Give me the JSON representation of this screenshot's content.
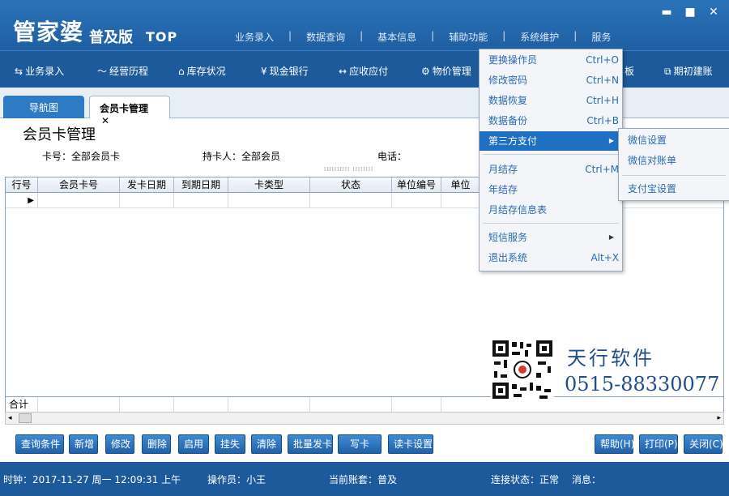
{
  "app": {
    "logo_main": "管家婆",
    "logo_sub": "普及版",
    "logo_top": "TOP",
    "top_menu": [
      "业务录入",
      "数据查询",
      "基本信息",
      "辅助功能",
      "系统维护",
      "服务"
    ]
  },
  "toolbar": {
    "items": [
      {
        "icon": "⇆",
        "label": "业务录入"
      },
      {
        "icon": "〜",
        "label": "经营历程"
      },
      {
        "icon": "⌂",
        "label": "库存状况"
      },
      {
        "icon": "¥",
        "label": "现金银行"
      },
      {
        "icon": "↔",
        "label": "应收应付"
      },
      {
        "icon": "⚙",
        "label": "物价管理"
      },
      {
        "icon": "",
        "label": "板"
      },
      {
        "icon": "⧉",
        "label": "期初建账"
      }
    ]
  },
  "tabs": {
    "nav": "导航图",
    "card": "会员卡管理",
    "close": "✕"
  },
  "page": {
    "title": "会员卡管理",
    "filter_card": "卡号：全部会员卡",
    "filter_holder": "持卡人：全部会员",
    "filter_phone": "电话："
  },
  "grid": {
    "columns": [
      "行号",
      "会员卡号",
      "发卡日期",
      "到期日期",
      "卡类型",
      "状态",
      "单位编号",
      "单位"
    ],
    "total_label": "合计"
  },
  "buttons": {
    "left": [
      "查询条件",
      "新增",
      "修改",
      "删除",
      "启用",
      "挂失",
      "清除",
      "批量发卡",
      "写卡",
      "读卡设置"
    ],
    "help": "帮助(H)",
    "print": "打印(P)",
    "close": "关闭(C)"
  },
  "status": {
    "clock": "时钟：2017-11-27 周一 12:09:31 上午",
    "operator": "操作员：小王",
    "account": "当前账套：普及",
    "connection": "连接状态：正常",
    "message": "消息："
  },
  "menu": {
    "items": [
      {
        "label": "更换操作员",
        "shortcut": "Ctrl+O"
      },
      {
        "label": "修改密码",
        "shortcut": "Ctrl+N"
      },
      {
        "label": "数据恢复",
        "shortcut": "Ctrl+H"
      },
      {
        "label": "数据备份",
        "shortcut": "Ctrl+B"
      },
      {
        "label": "第三方支付",
        "shortcut": "▶"
      },
      {
        "label": "月结存",
        "shortcut": "Ctrl+M"
      },
      {
        "label": "年结存",
        "shortcut": ""
      },
      {
        "label": "月结存信息表",
        "shortcut": ""
      },
      {
        "label": "短信服务",
        "shortcut": "▶"
      },
      {
        "label": "退出系统",
        "shortcut": "Alt+X"
      }
    ],
    "submenu": [
      "微信设置",
      "微信对账单",
      "支付宝设置"
    ]
  },
  "ad": {
    "company": "天行软件",
    "phone": "0515-88330077"
  },
  "colors": {
    "primary": "#1d5a9c",
    "menu_active": "#1f6fc2",
    "menu_text": "#2a6ab0"
  }
}
